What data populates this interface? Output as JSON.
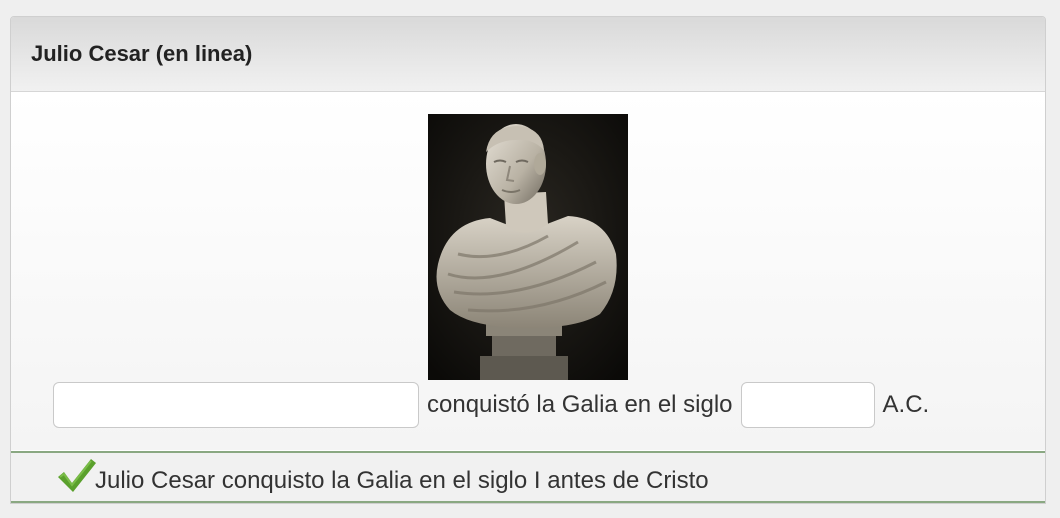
{
  "question": {
    "title": "Julio Cesar (en linea)",
    "image": {
      "alt": "Busto de Julio Cesar"
    },
    "sentence": {
      "blank_1_value": "",
      "text_middle": "conquistó la Galia en el siglo",
      "blank_2_value": "",
      "text_end": "A.C."
    },
    "feedback": {
      "icon": "check-icon",
      "icon_color": "#5aa02c",
      "text": "Julio Cesar conquisto la Galia en el siglo I antes de Cristo"
    }
  }
}
